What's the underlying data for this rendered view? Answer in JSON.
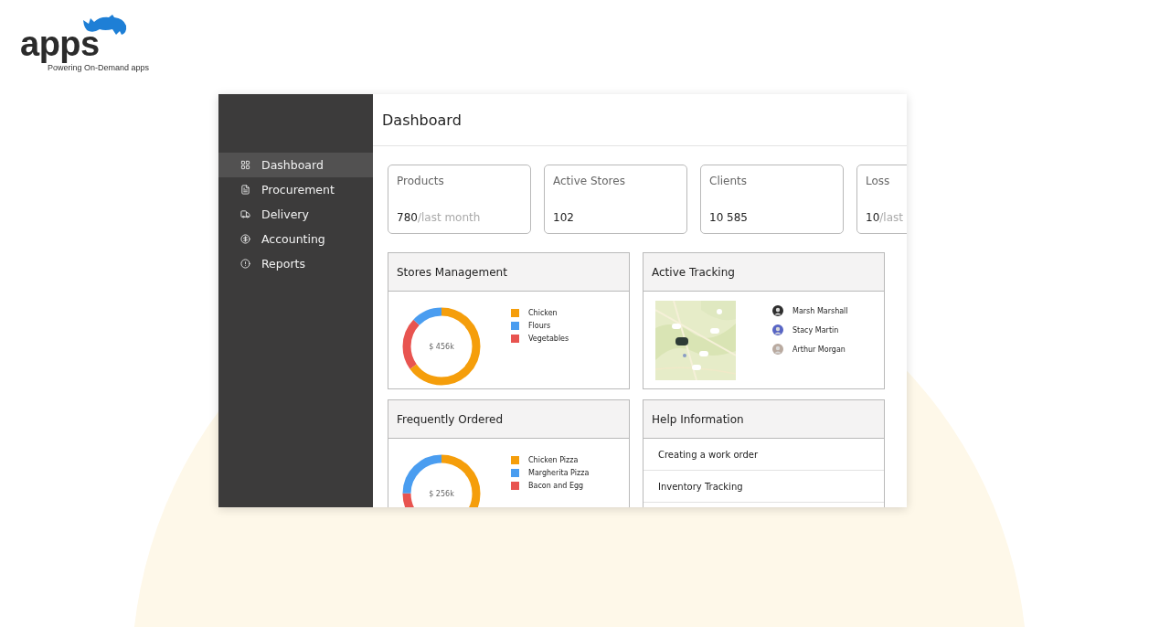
{
  "brand": {
    "name": "apps",
    "tagline": "Powering On-Demand apps"
  },
  "sidebar": {
    "items": [
      {
        "label": "Dashboard",
        "selected": true
      },
      {
        "label": "Procurement",
        "selected": false
      },
      {
        "label": "Delivery",
        "selected": false
      },
      {
        "label": "Accounting",
        "selected": false
      },
      {
        "label": "Reports",
        "selected": false
      }
    ]
  },
  "header": {
    "title": "Dashboard"
  },
  "stats": [
    {
      "label": "Products",
      "value": "780",
      "suffix": "/last month"
    },
    {
      "label": "Active Stores",
      "value": "102"
    },
    {
      "label": "Clients",
      "value": "10 585"
    },
    {
      "label": "Loss",
      "value": "10",
      "suffix": "/last"
    }
  ],
  "panels": [
    {
      "kind": "donut",
      "title": "Stores Management",
      "total": "$ 456k",
      "legend": [
        {
          "label": "Chicken",
          "color": "#f59e0b"
        },
        {
          "label": "Flours",
          "color": "#4a9df0"
        },
        {
          "label": "Vegetables",
          "color": "#e85450"
        }
      ]
    },
    {
      "kind": "tracking",
      "title": "Active Tracking",
      "people": [
        {
          "name": "Marsh Marshall"
        },
        {
          "name": "Stacy Martin"
        },
        {
          "name": "Arthur Morgan"
        }
      ]
    },
    {
      "kind": "donut",
      "title": "Frequently Ordered",
      "total": "$ 256k",
      "legend": [
        {
          "label": "Chicken Pizza",
          "color": "#f59e0b"
        },
        {
          "label": "Margherita Pizza",
          "color": "#4a9df0"
        },
        {
          "label": "Bacon and Egg",
          "color": "#e85450"
        }
      ]
    },
    {
      "kind": "help",
      "title": "Help Information",
      "links": [
        "Creating a work order",
        "Inventory Tracking"
      ]
    }
  ]
}
